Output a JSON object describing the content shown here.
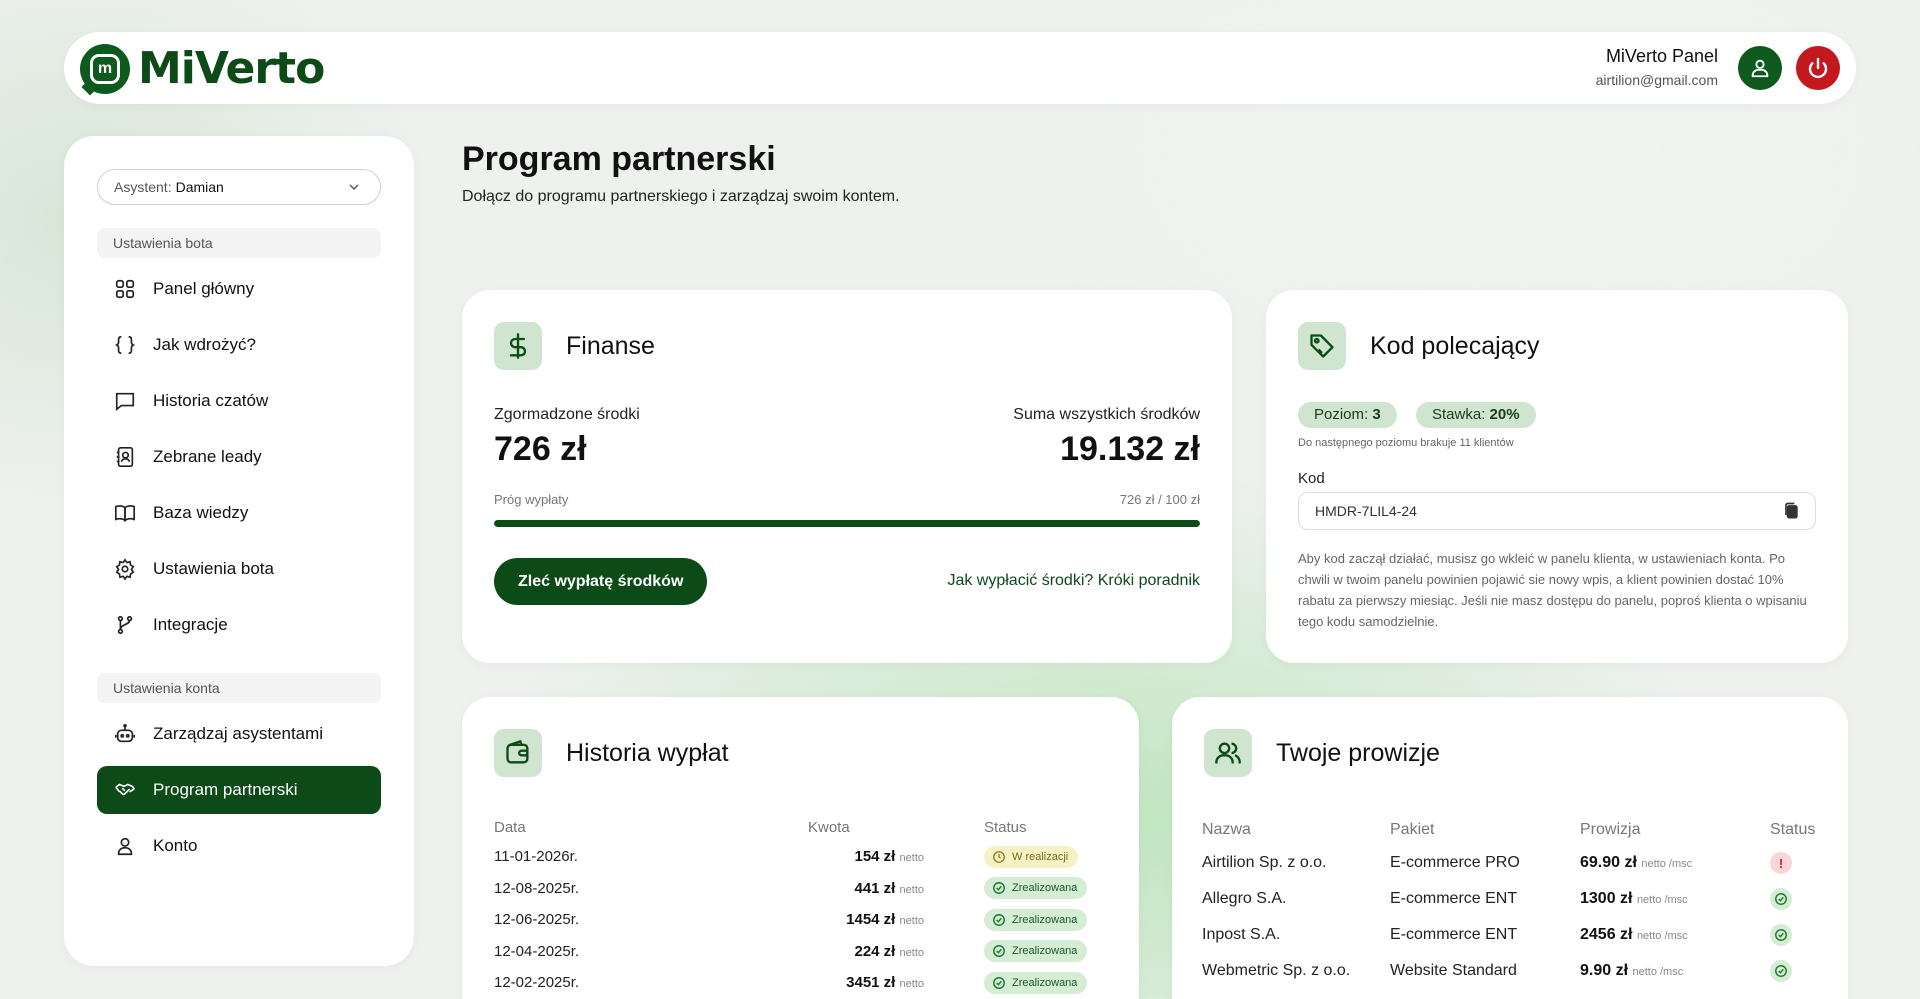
{
  "header": {
    "logo_text": "MiVerto",
    "user_name": "MiVerto Panel",
    "user_email": "airtilion@gmail.com"
  },
  "sidebar": {
    "assistant_label": "Asystent:",
    "assistant_value": "Damian",
    "bot_section": "Ustawienia bota",
    "bot_items": [
      {
        "label": "Panel główny",
        "icon": "grid-icon"
      },
      {
        "label": "Jak wdrożyć?",
        "icon": "braces-icon"
      },
      {
        "label": "Historia czatów",
        "icon": "chat-icon"
      },
      {
        "label": "Zebrane leady",
        "icon": "contacts-icon"
      },
      {
        "label": "Baza wiedzy",
        "icon": "book-icon"
      },
      {
        "label": "Ustawienia bota",
        "icon": "gear-icon"
      },
      {
        "label": "Integracje",
        "icon": "branch-icon"
      }
    ],
    "account_section": "Ustawienia konta",
    "account_items": [
      {
        "label": "Zarządzaj asystentami",
        "icon": "robot-icon"
      },
      {
        "label": "Program partnerski",
        "icon": "handshake-icon",
        "active": true
      },
      {
        "label": "Konto",
        "icon": "user-icon"
      }
    ]
  },
  "page": {
    "title": "Program partnerski",
    "subtitle": "Dołącz do programu partnerskiego i zarządzaj swoim kontem."
  },
  "finance": {
    "title": "Finanse",
    "collected_label": "Zgormadzone środki",
    "collected_value": "726 zł",
    "total_label": "Suma wszystkich środków",
    "total_value": "19.132 zł",
    "threshold_label": "Próg wypłaty",
    "threshold_value": "726 zł / 100 zł",
    "progress_fraction": 1.0,
    "payout_button": "Zleć wypłatę środków",
    "guide_link": "Jak wypłacić środki? Króki poradnik"
  },
  "referral": {
    "title": "Kod polecający",
    "level_label": "Poziom:",
    "level_value": "3",
    "rate_label": "Stawka:",
    "rate_value": "20%",
    "next_level_note": "Do następnego poziomu brakuje 11 klientów",
    "code_label": "Kod",
    "code_value": "HMDR-7LIL4-24",
    "description": "Aby kod zaczął działać, musisz go wkleić w panelu klienta, w ustawieniach konta. Po chwili w twoim panelu powinien pojawić sie nowy wpis, a klient powinien dostać 10% rabatu za pierwszy miesiąc. Jeśli nie masz dostępu do panelu, poproś klienta o wpisaniu tego kodu samodzielnie."
  },
  "payouts": {
    "title": "Historia wypłat",
    "columns": [
      "Data",
      "Kwota",
      "Status"
    ],
    "net_label": "netto",
    "rows": [
      {
        "date": "11-01-2026r.",
        "amount": "154 zł",
        "status": "W realizacji",
        "state": "wip"
      },
      {
        "date": "12-08-2025r.",
        "amount": "441 zł",
        "status": "Zrealizowana",
        "state": "ok"
      },
      {
        "date": "12-06-2025r.",
        "amount": "1454 zł",
        "status": "Zrealizowana",
        "state": "ok"
      },
      {
        "date": "12-04-2025r.",
        "amount": "224 zł",
        "status": "Zrealizowana",
        "state": "ok"
      },
      {
        "date": "12-02-2025r.",
        "amount": "3451 zł",
        "status": "Zrealizowana",
        "state": "ok"
      }
    ]
  },
  "commissions": {
    "title": "Twoje prowizje",
    "columns": [
      "Nazwa",
      "Pakiet",
      "Prowizja",
      "Status"
    ],
    "suffix": "netto /msc",
    "rows": [
      {
        "name": "Airtilion Sp. z o.o.",
        "package": "E-commerce PRO",
        "commission": "69.90 zł",
        "state": "error"
      },
      {
        "name": "Allegro S.A.",
        "package": "E-commerce ENT",
        "commission": "1300 zł",
        "state": "ok"
      },
      {
        "name": "Inpost S.A.",
        "package": "E-commerce ENT",
        "commission": "2456 zł",
        "state": "ok"
      },
      {
        "name": "Webmetric Sp. z o.o.",
        "package": "Website Standard",
        "commission": "9.90 zł",
        "state": "ok"
      }
    ]
  },
  "colors": {
    "brand": "#0c4a17",
    "danger": "#c4171e",
    "accent_soft": "#cfe5cf"
  }
}
